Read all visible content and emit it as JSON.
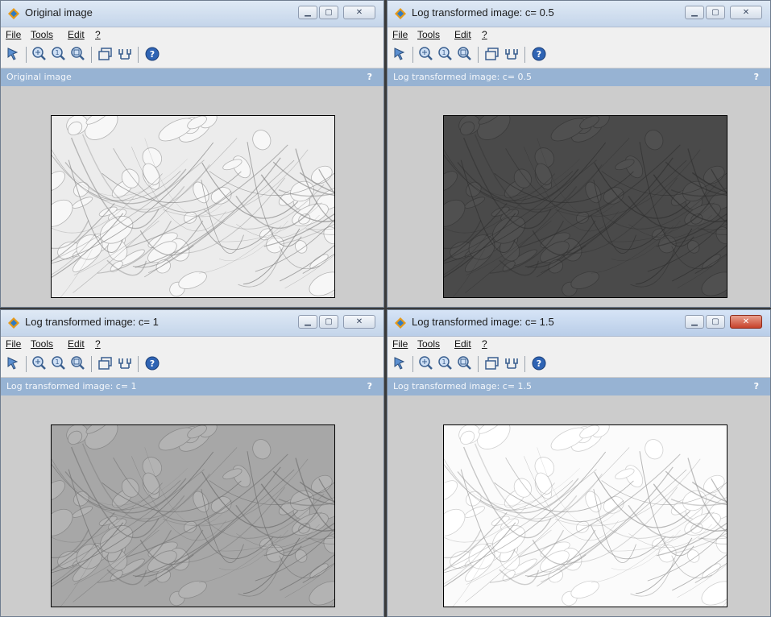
{
  "menu": [
    "File",
    "Tools",
    "Edit",
    "?"
  ],
  "toolbar_icons": [
    "cursor-icon",
    "zoom-grid-icon",
    "zoom-in-icon",
    "zoom-fit-icon",
    "window-icon",
    "profile-icon",
    "help-icon"
  ],
  "windows": [
    {
      "title": "Original image",
      "header": "Original image",
      "help": "?",
      "tone": "original",
      "active": false
    },
    {
      "title": "Log transformed image: c= 0.5",
      "header": "Log transformed image: c= 0.5",
      "help": "?",
      "tone": "dark",
      "active": false
    },
    {
      "title": "Log transformed image: c= 1",
      "header": "Log transformed image: c= 1",
      "help": "?",
      "tone": "mid",
      "active": false
    },
    {
      "title": "Log transformed image: c= 1.5",
      "header": "Log transformed image: c= 1.5",
      "help": "?",
      "tone": "bright",
      "active": true
    }
  ],
  "colors": {
    "header_bg": "#97b3d3",
    "window_bg": "#cccccc",
    "close_active": "#c7422b"
  }
}
